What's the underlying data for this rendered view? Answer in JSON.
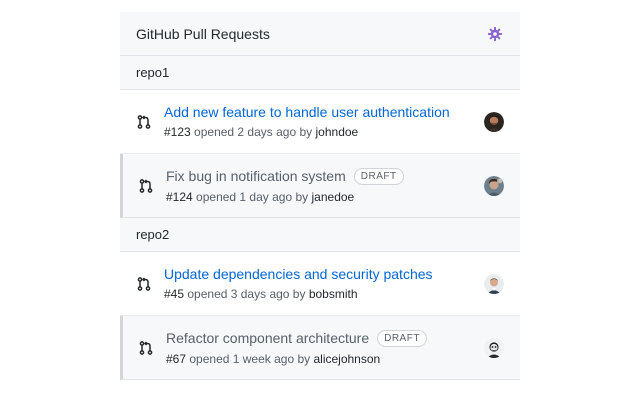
{
  "header": {
    "title": "GitHub Pull Requests",
    "settings_icon": "gear-icon"
  },
  "repos": [
    {
      "name": "repo1",
      "prs": [
        {
          "title": "Add new feature to handle user authentication",
          "number": "#123",
          "opened_text": "opened 2 days ago by",
          "author": "johndoe",
          "draft": false
        },
        {
          "title": "Fix bug in notification system",
          "number": "#124",
          "opened_text": "opened 1 day ago by",
          "author": "janedoe",
          "draft": true,
          "badge": "DRAFT"
        }
      ]
    },
    {
      "name": "repo2",
      "prs": [
        {
          "title": "Update dependencies and security patches",
          "number": "#45",
          "opened_text": "opened 3 days ago by",
          "author": "bobsmith",
          "draft": false
        },
        {
          "title": "Refactor component architecture",
          "number": "#67",
          "opened_text": "opened 1 week ago by",
          "author": "alicejohnson",
          "draft": true,
          "badge": "DRAFT"
        }
      ]
    }
  ],
  "colors": {
    "link": "#0366d6",
    "muted": "#586069",
    "header_bg": "#f6f8fa",
    "gear": "#8a63d2"
  }
}
